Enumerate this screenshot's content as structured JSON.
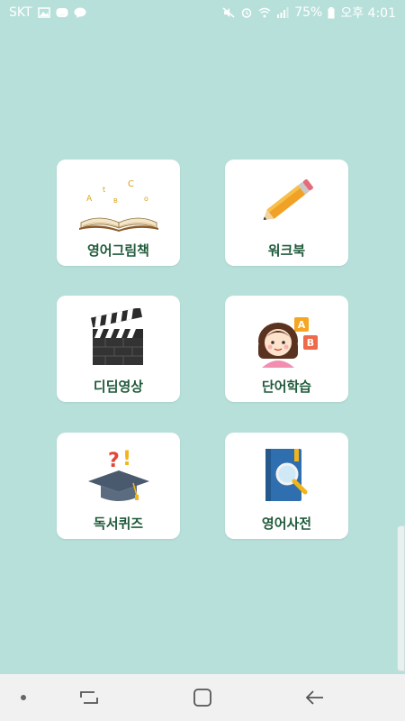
{
  "status_bar": {
    "carrier": "SKT",
    "battery": "75%",
    "time": "오후 4:01"
  },
  "menu": [
    {
      "label": "영어그림책",
      "icon": "open-book-icon"
    },
    {
      "label": "워크북",
      "icon": "pencil-icon"
    },
    {
      "label": "디딤영상",
      "icon": "clapperboard-icon"
    },
    {
      "label": "단어학습",
      "icon": "child-abc-blocks-icon"
    },
    {
      "label": "독서퀴즈",
      "icon": "graduation-cap-question-icon"
    },
    {
      "label": "영어사전",
      "icon": "dictionary-magnifier-icon"
    }
  ],
  "nav": {
    "recent": "recent-apps-icon",
    "home": "home-icon",
    "back": "back-icon"
  },
  "colors": {
    "background": "#b8e0db",
    "card": "#ffffff",
    "label": "#1f5a3b"
  }
}
